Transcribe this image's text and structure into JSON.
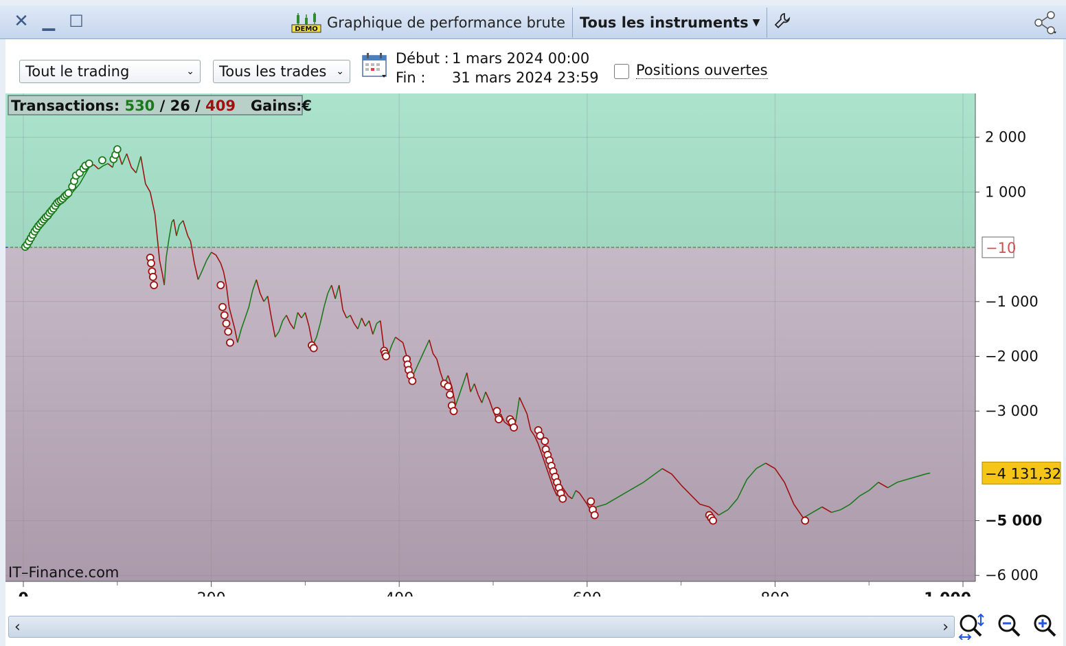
{
  "window": {
    "title": "Graphique de performance brute",
    "instrument_selector": "Tous les instruments",
    "close_icon": "close-icon",
    "minimize_icon": "minimize-icon",
    "maximize_icon": "maximize-icon",
    "settings_icon": "wrench-icon",
    "share_icon": "share-icon",
    "demo_badge": "DEMO"
  },
  "filters": {
    "trading_scope": "Tout le trading",
    "trade_type": "Tous les trades",
    "start_label": "Début :",
    "start_value": "1 mars 2024 00:00",
    "end_label": "Fin :",
    "end_value": "31 mars 2024 23:59",
    "open_positions_label": "Positions ouvertes",
    "open_positions_checked": false
  },
  "stats": {
    "transactions_label": "Transactions:",
    "wins": "530",
    "slash1": "/",
    "breakeven": "26",
    "slash2": "/",
    "losses": "409",
    "gains_label": "Gains:",
    "currency": "€"
  },
  "watermark": "IT–Finance.com",
  "colors": {
    "gain": "#1a7a1a",
    "loss": "#a01010",
    "positive_zone": "#a6e0c8",
    "negative_zone": "#c2b3c0",
    "last_value_bg": "#f5c518"
  },
  "chart_data": {
    "type": "line",
    "xlim": [
      0,
      1000
    ],
    "ylim": [
      -6200,
      2800
    ],
    "x_ticks": [
      "0",
      "200",
      "400",
      "600",
      "800",
      "1 000"
    ],
    "y_ticks": [
      "2 000",
      "1 000",
      "-10",
      "−1 000",
      "−2 000",
      "−3 000",
      "−4 131,32",
      "−5 000",
      "−6 000"
    ],
    "y_tick_values": [
      2000,
      1000,
      -1000,
      -2000,
      -3000,
      -5000,
      -6000
    ],
    "y_tick_texts": [
      "2 000",
      "1 000",
      "−1 000",
      "−2 000",
      "−3 000",
      "−5 000",
      "−6 000"
    ],
    "zero_line_label": "−10",
    "zero_line_value": -10,
    "last_value_label": "−4 131,32",
    "last_value": -4131.32,
    "series": [
      {
        "points": [
          [
            0,
            0
          ],
          [
            5,
            100
          ],
          [
            10,
            250
          ],
          [
            15,
            380
          ],
          [
            20,
            450
          ],
          [
            25,
            520
          ],
          [
            30,
            620
          ],
          [
            35,
            700
          ],
          [
            40,
            800
          ],
          [
            45,
            880
          ],
          [
            50,
            950
          ],
          [
            55,
            1050
          ],
          [
            60,
            1150
          ],
          [
            65,
            1300
          ],
          [
            70,
            1450
          ],
          [
            75,
            1500
          ],
          [
            80,
            1420
          ],
          [
            85,
            1480
          ],
          [
            90,
            1520
          ],
          [
            95,
            1450
          ],
          [
            100,
            1780
          ],
          [
            105,
            1500
          ],
          [
            110,
            1700
          ],
          [
            115,
            1450
          ],
          [
            120,
            1350
          ],
          [
            125,
            1650
          ],
          [
            130,
            1150
          ],
          [
            135,
            1000
          ],
          [
            140,
            600
          ],
          [
            145,
            -250
          ],
          [
            148,
            -500
          ],
          [
            150,
            -700
          ],
          [
            152,
            -200
          ],
          [
            155,
            150
          ],
          [
            158,
            450
          ],
          [
            160,
            500
          ],
          [
            163,
            200
          ],
          [
            166,
            400
          ],
          [
            170,
            480
          ],
          [
            175,
            200
          ],
          [
            178,
            100
          ],
          [
            182,
            -300
          ],
          [
            186,
            -600
          ],
          [
            190,
            -450
          ],
          [
            195,
            -250
          ],
          [
            200,
            -100
          ],
          [
            205,
            -150
          ],
          [
            210,
            -300
          ],
          [
            213,
            -450
          ],
          [
            216,
            -700
          ],
          [
            219,
            -1100
          ],
          [
            222,
            -1300
          ],
          [
            225,
            -1500
          ],
          [
            228,
            -1750
          ],
          [
            232,
            -1500
          ],
          [
            236,
            -1300
          ],
          [
            240,
            -1100
          ],
          [
            244,
            -800
          ],
          [
            248,
            -600
          ],
          [
            252,
            -850
          ],
          [
            256,
            -1000
          ],
          [
            260,
            -900
          ],
          [
            264,
            -1300
          ],
          [
            268,
            -1650
          ],
          [
            272,
            -1550
          ],
          [
            276,
            -1350
          ],
          [
            280,
            -1250
          ],
          [
            284,
            -1400
          ],
          [
            288,
            -1500
          ],
          [
            292,
            -1200
          ],
          [
            296,
            -1300
          ],
          [
            300,
            -1200
          ],
          [
            304,
            -1450
          ],
          [
            308,
            -1800
          ],
          [
            312,
            -1650
          ],
          [
            316,
            -1400
          ],
          [
            320,
            -1100
          ],
          [
            324,
            -850
          ],
          [
            328,
            -700
          ],
          [
            332,
            -950
          ],
          [
            336,
            -700
          ],
          [
            340,
            -1150
          ],
          [
            344,
            -1300
          ],
          [
            348,
            -1250
          ],
          [
            352,
            -1400
          ],
          [
            356,
            -1500
          ],
          [
            360,
            -1300
          ],
          [
            364,
            -1450
          ],
          [
            368,
            -1350
          ],
          [
            372,
            -1600
          ],
          [
            376,
            -1400
          ],
          [
            380,
            -1350
          ],
          [
            384,
            -1900
          ],
          [
            388,
            -2000
          ],
          [
            392,
            -1800
          ],
          [
            396,
            -1650
          ],
          [
            400,
            -1700
          ],
          [
            404,
            -1750
          ],
          [
            408,
            -2000
          ],
          [
            412,
            -2400
          ],
          [
            416,
            -2300
          ],
          [
            420,
            -2150
          ],
          [
            424,
            -2000
          ],
          [
            428,
            -1850
          ],
          [
            432,
            -1700
          ],
          [
            436,
            -1950
          ],
          [
            440,
            -2050
          ],
          [
            444,
            -2300
          ],
          [
            448,
            -2500
          ],
          [
            452,
            -2350
          ],
          [
            456,
            -2550
          ],
          [
            460,
            -2900
          ],
          [
            464,
            -2700
          ],
          [
            468,
            -2500
          ],
          [
            472,
            -2300
          ],
          [
            476,
            -2650
          ],
          [
            480,
            -2500
          ],
          [
            484,
            -2700
          ],
          [
            488,
            -2850
          ],
          [
            492,
            -2650
          ],
          [
            496,
            -2800
          ],
          [
            500,
            -3000
          ],
          [
            504,
            -3150
          ],
          [
            508,
            -3050
          ],
          [
            512,
            -3200
          ],
          [
            516,
            -3250
          ],
          [
            520,
            -3300
          ],
          [
            524,
            -3200
          ],
          [
            528,
            -2750
          ],
          [
            532,
            -2900
          ],
          [
            536,
            -3050
          ],
          [
            540,
            -3350
          ],
          [
            544,
            -3450
          ],
          [
            548,
            -3600
          ],
          [
            552,
            -3800
          ],
          [
            556,
            -4000
          ],
          [
            560,
            -4200
          ],
          [
            564,
            -4400
          ],
          [
            568,
            -4550
          ],
          [
            572,
            -4350
          ],
          [
            576,
            -4450
          ],
          [
            580,
            -4550
          ],
          [
            584,
            -4600
          ],
          [
            588,
            -4450
          ],
          [
            592,
            -4500
          ],
          [
            596,
            -4600
          ],
          [
            600,
            -4700
          ],
          [
            605,
            -4850
          ],
          [
            610,
            -4750
          ],
          [
            620,
            -4700
          ],
          [
            640,
            -4500
          ],
          [
            660,
            -4300
          ],
          [
            680,
            -4050
          ],
          [
            690,
            -4150
          ],
          [
            700,
            -4350
          ],
          [
            720,
            -4700
          ],
          [
            730,
            -4750
          ],
          [
            740,
            -4900
          ],
          [
            750,
            -4800
          ],
          [
            760,
            -4600
          ],
          [
            770,
            -4250
          ],
          [
            780,
            -4050
          ],
          [
            790,
            -3950
          ],
          [
            800,
            -4050
          ],
          [
            810,
            -4300
          ],
          [
            820,
            -4700
          ],
          [
            830,
            -4950
          ],
          [
            840,
            -4850
          ],
          [
            850,
            -4750
          ],
          [
            860,
            -4850
          ],
          [
            870,
            -4800
          ],
          [
            880,
            -4700
          ],
          [
            890,
            -4550
          ],
          [
            900,
            -4450
          ],
          [
            910,
            -4300
          ],
          [
            920,
            -4400
          ],
          [
            930,
            -4300
          ],
          [
            940,
            -4250
          ],
          [
            950,
            -4200
          ],
          [
            960,
            -4150
          ],
          [
            965,
            -4131
          ]
        ]
      }
    ],
    "loss_markers": [
      [
        135,
        -200
      ],
      [
        136,
        -300
      ],
      [
        137,
        -450
      ],
      [
        138,
        -550
      ],
      [
        139,
        -700
      ],
      [
        210,
        -700
      ],
      [
        212,
        -1100
      ],
      [
        214,
        -1250
      ],
      [
        216,
        -1400
      ],
      [
        218,
        -1550
      ],
      [
        220,
        -1750
      ],
      [
        307,
        -1800
      ],
      [
        309,
        -1850
      ],
      [
        384,
        -1900
      ],
      [
        385,
        -1950
      ],
      [
        386,
        -2000
      ],
      [
        408,
        -2050
      ],
      [
        409,
        -2150
      ],
      [
        410,
        -2250
      ],
      [
        412,
        -2350
      ],
      [
        414,
        -2450
      ],
      [
        448,
        -2500
      ],
      [
        452,
        -2550
      ],
      [
        454,
        -2700
      ],
      [
        456,
        -2900
      ],
      [
        458,
        -3000
      ],
      [
        504,
        -3000
      ],
      [
        506,
        -3150
      ],
      [
        518,
        -3150
      ],
      [
        520,
        -3200
      ],
      [
        522,
        -3300
      ],
      [
        548,
        -3350
      ],
      [
        550,
        -3450
      ],
      [
        555,
        -3550
      ],
      [
        556,
        -3700
      ],
      [
        558,
        -3800
      ],
      [
        560,
        -3900
      ],
      [
        562,
        -4000
      ],
      [
        564,
        -4100
      ],
      [
        566,
        -4200
      ],
      [
        568,
        -4300
      ],
      [
        570,
        -4400
      ],
      [
        572,
        -4500
      ],
      [
        574,
        -4600
      ],
      [
        604,
        -4650
      ],
      [
        606,
        -4800
      ],
      [
        608,
        -4900
      ],
      [
        730,
        -4900
      ],
      [
        732,
        -4950
      ],
      [
        734,
        -5000
      ],
      [
        832,
        -5000
      ]
    ],
    "gain_markers": [
      [
        2,
        0
      ],
      [
        4,
        40
      ],
      [
        6,
        100
      ],
      [
        8,
        160
      ],
      [
        10,
        220
      ],
      [
        12,
        280
      ],
      [
        14,
        330
      ],
      [
        16,
        380
      ],
      [
        18,
        420
      ],
      [
        20,
        460
      ],
      [
        22,
        500
      ],
      [
        24,
        540
      ],
      [
        26,
        570
      ],
      [
        28,
        620
      ],
      [
        30,
        660
      ],
      [
        32,
        700
      ],
      [
        34,
        750
      ],
      [
        36,
        800
      ],
      [
        38,
        830
      ],
      [
        40,
        850
      ],
      [
        42,
        880
      ],
      [
        44,
        920
      ],
      [
        46,
        950
      ],
      [
        48,
        980
      ],
      [
        52,
        1100
      ],
      [
        54,
        1200
      ],
      [
        56,
        1300
      ],
      [
        60,
        1350
      ],
      [
        64,
        1430
      ],
      [
        66,
        1480
      ],
      [
        70,
        1520
      ],
      [
        84,
        1580
      ],
      [
        96,
        1600
      ],
      [
        98,
        1680
      ],
      [
        100,
        1780
      ]
    ],
    "grid": true
  },
  "scroll": {
    "left_arrow": "‹",
    "right_arrow": "›"
  },
  "zoom_controls": [
    "zoom-fit-icon",
    "zoom-out-icon",
    "zoom-in-icon"
  ]
}
